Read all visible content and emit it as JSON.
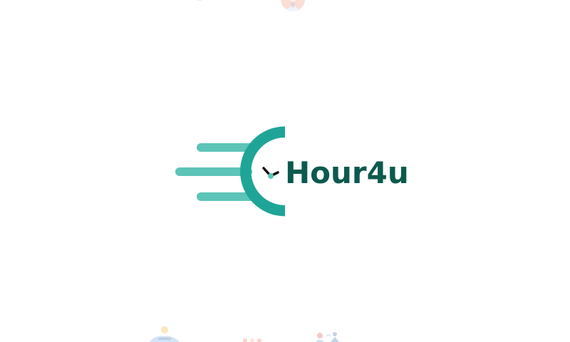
{
  "splash": {
    "brand_name": "Hour4u",
    "logo_icon": "speeding-clock-icon",
    "colors": {
      "background": "#ffffff",
      "speed_lines": "#5cc4b8",
      "clock_arc": "#1fa597",
      "clock_center": "#5cc4b8",
      "clock_hands": "#111111",
      "wordmark": "#0b5a4e"
    }
  },
  "faint_decor": {
    "top_avatar_icon": "person-avatar-icon",
    "bottom_illustrations": [
      "person-at-laptop-illustration",
      "group-people-illustration",
      "people-meeting-illustration"
    ]
  }
}
